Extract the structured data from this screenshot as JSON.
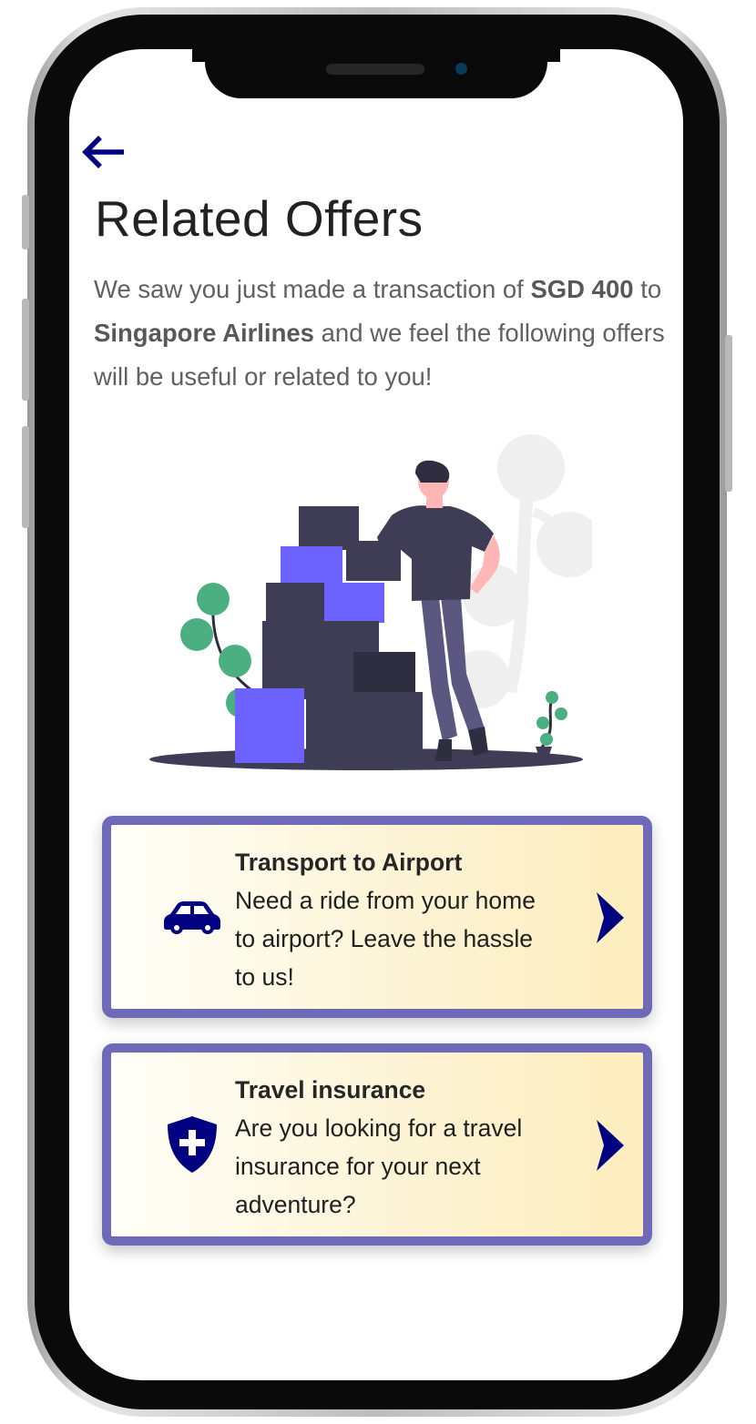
{
  "header": {
    "back_icon": "arrow-left-icon",
    "title": "Related Offers"
  },
  "intro": {
    "prefix": "We saw you just made a transaction of ",
    "amount": "SGD 400",
    "middle": " to ",
    "merchant": "Singapore Airlines",
    "suffix": " and we feel the following offers will be useful or related to you!"
  },
  "offers": [
    {
      "icon": "car-icon",
      "title": "Transport to Airport",
      "description": "Need a ride from your home to airport? Leave the hassle to us!"
    },
    {
      "icon": "shield-plus-icon",
      "title": "Travel insurance",
      "description": "Are you looking for a travel insurance for your next adventure?"
    }
  ],
  "colors": {
    "accent": "#000080",
    "card_border": "#6f6ab8",
    "card_gradient_end": "#fdedbd",
    "illustration_purple": "#6c63ff",
    "illustration_dark": "#3f3d56"
  }
}
